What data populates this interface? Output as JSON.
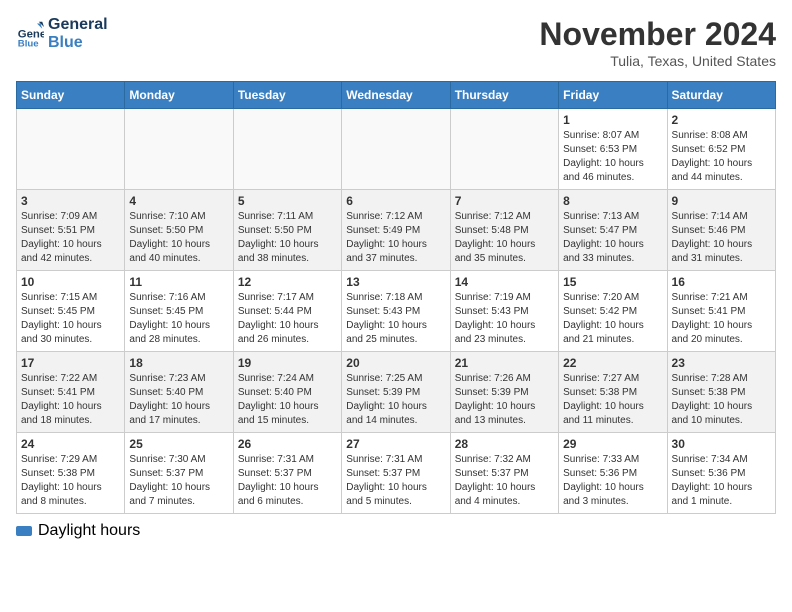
{
  "logo": {
    "line1": "General",
    "line2": "Blue"
  },
  "title": "November 2024",
  "location": "Tulia, Texas, United States",
  "days_of_week": [
    "Sunday",
    "Monday",
    "Tuesday",
    "Wednesday",
    "Thursday",
    "Friday",
    "Saturday"
  ],
  "weeks": [
    [
      {
        "day": "",
        "info": ""
      },
      {
        "day": "",
        "info": ""
      },
      {
        "day": "",
        "info": ""
      },
      {
        "day": "",
        "info": ""
      },
      {
        "day": "",
        "info": ""
      },
      {
        "day": "1",
        "info": "Sunrise: 8:07 AM\nSunset: 6:53 PM\nDaylight: 10 hours and 46 minutes."
      },
      {
        "day": "2",
        "info": "Sunrise: 8:08 AM\nSunset: 6:52 PM\nDaylight: 10 hours and 44 minutes."
      }
    ],
    [
      {
        "day": "3",
        "info": "Sunrise: 7:09 AM\nSunset: 5:51 PM\nDaylight: 10 hours and 42 minutes."
      },
      {
        "day": "4",
        "info": "Sunrise: 7:10 AM\nSunset: 5:50 PM\nDaylight: 10 hours and 40 minutes."
      },
      {
        "day": "5",
        "info": "Sunrise: 7:11 AM\nSunset: 5:50 PM\nDaylight: 10 hours and 38 minutes."
      },
      {
        "day": "6",
        "info": "Sunrise: 7:12 AM\nSunset: 5:49 PM\nDaylight: 10 hours and 37 minutes."
      },
      {
        "day": "7",
        "info": "Sunrise: 7:12 AM\nSunset: 5:48 PM\nDaylight: 10 hours and 35 minutes."
      },
      {
        "day": "8",
        "info": "Sunrise: 7:13 AM\nSunset: 5:47 PM\nDaylight: 10 hours and 33 minutes."
      },
      {
        "day": "9",
        "info": "Sunrise: 7:14 AM\nSunset: 5:46 PM\nDaylight: 10 hours and 31 minutes."
      }
    ],
    [
      {
        "day": "10",
        "info": "Sunrise: 7:15 AM\nSunset: 5:45 PM\nDaylight: 10 hours and 30 minutes."
      },
      {
        "day": "11",
        "info": "Sunrise: 7:16 AM\nSunset: 5:45 PM\nDaylight: 10 hours and 28 minutes."
      },
      {
        "day": "12",
        "info": "Sunrise: 7:17 AM\nSunset: 5:44 PM\nDaylight: 10 hours and 26 minutes."
      },
      {
        "day": "13",
        "info": "Sunrise: 7:18 AM\nSunset: 5:43 PM\nDaylight: 10 hours and 25 minutes."
      },
      {
        "day": "14",
        "info": "Sunrise: 7:19 AM\nSunset: 5:43 PM\nDaylight: 10 hours and 23 minutes."
      },
      {
        "day": "15",
        "info": "Sunrise: 7:20 AM\nSunset: 5:42 PM\nDaylight: 10 hours and 21 minutes."
      },
      {
        "day": "16",
        "info": "Sunrise: 7:21 AM\nSunset: 5:41 PM\nDaylight: 10 hours and 20 minutes."
      }
    ],
    [
      {
        "day": "17",
        "info": "Sunrise: 7:22 AM\nSunset: 5:41 PM\nDaylight: 10 hours and 18 minutes."
      },
      {
        "day": "18",
        "info": "Sunrise: 7:23 AM\nSunset: 5:40 PM\nDaylight: 10 hours and 17 minutes."
      },
      {
        "day": "19",
        "info": "Sunrise: 7:24 AM\nSunset: 5:40 PM\nDaylight: 10 hours and 15 minutes."
      },
      {
        "day": "20",
        "info": "Sunrise: 7:25 AM\nSunset: 5:39 PM\nDaylight: 10 hours and 14 minutes."
      },
      {
        "day": "21",
        "info": "Sunrise: 7:26 AM\nSunset: 5:39 PM\nDaylight: 10 hours and 13 minutes."
      },
      {
        "day": "22",
        "info": "Sunrise: 7:27 AM\nSunset: 5:38 PM\nDaylight: 10 hours and 11 minutes."
      },
      {
        "day": "23",
        "info": "Sunrise: 7:28 AM\nSunset: 5:38 PM\nDaylight: 10 hours and 10 minutes."
      }
    ],
    [
      {
        "day": "24",
        "info": "Sunrise: 7:29 AM\nSunset: 5:38 PM\nDaylight: 10 hours and 8 minutes."
      },
      {
        "day": "25",
        "info": "Sunrise: 7:30 AM\nSunset: 5:37 PM\nDaylight: 10 hours and 7 minutes."
      },
      {
        "day": "26",
        "info": "Sunrise: 7:31 AM\nSunset: 5:37 PM\nDaylight: 10 hours and 6 minutes."
      },
      {
        "day": "27",
        "info": "Sunrise: 7:31 AM\nSunset: 5:37 PM\nDaylight: 10 hours and 5 minutes."
      },
      {
        "day": "28",
        "info": "Sunrise: 7:32 AM\nSunset: 5:37 PM\nDaylight: 10 hours and 4 minutes."
      },
      {
        "day": "29",
        "info": "Sunrise: 7:33 AM\nSunset: 5:36 PM\nDaylight: 10 hours and 3 minutes."
      },
      {
        "day": "30",
        "info": "Sunrise: 7:34 AM\nSunset: 5:36 PM\nDaylight: 10 hours and 1 minute."
      }
    ]
  ],
  "legend": {
    "label": "Daylight hours"
  }
}
